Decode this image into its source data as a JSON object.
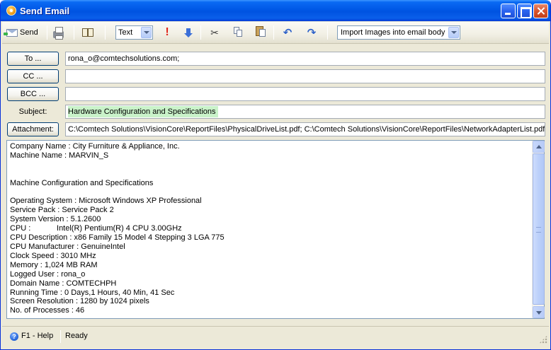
{
  "window": {
    "title": "Send Email"
  },
  "toolbar": {
    "send_label": "Send",
    "format_value": "Text",
    "import_value": "Import Images into email body"
  },
  "header": {
    "to_label": "To ...",
    "to_value": "rona_o@comtechsolutions.com;",
    "cc_label": "CC ...",
    "cc_value": "",
    "bcc_label": "BCC ...",
    "bcc_value": "",
    "subject_label": "Subject:",
    "subject_value": "Hardware Configuration and Specifications",
    "attachment_label": "Attachment:",
    "attachment_value": "C:\\Comtech Solutions\\VisionCore\\ReportFiles\\PhysicalDriveList.pdf; C:\\Comtech Solutions\\VisionCore\\ReportFiles\\NetworkAdapterList.pdf;"
  },
  "body": {
    "text": "Company Name : City Furniture & Appliance, Inc.\nMachine Name : MARVIN_S\n\n\nMachine Configuration and Specifications\n\nOperating System : Microsoft Windows XP Professional\nService Pack : Service Pack 2\nSystem Version : 5.1.2600\nCPU :            Intel(R) Pentium(R) 4 CPU 3.00GHz\nCPU Description : x86 Family 15 Model 4 Stepping 3 LGA 775\nCPU Manufacturer : GenuineIntel\nClock Speed : 3010 MHz\nMemory : 1,024 MB RAM\nLogged User : rona_o\nDomain Name : COMTECHPH\nRunning Time : 0 Days,1 Hours, 40 Min, 41 Sec\nScreen Resolution : 1280 by 1024 pixels\nNo. of Processes : 46"
  },
  "status": {
    "help": "F1 - Help",
    "state": "Ready"
  }
}
